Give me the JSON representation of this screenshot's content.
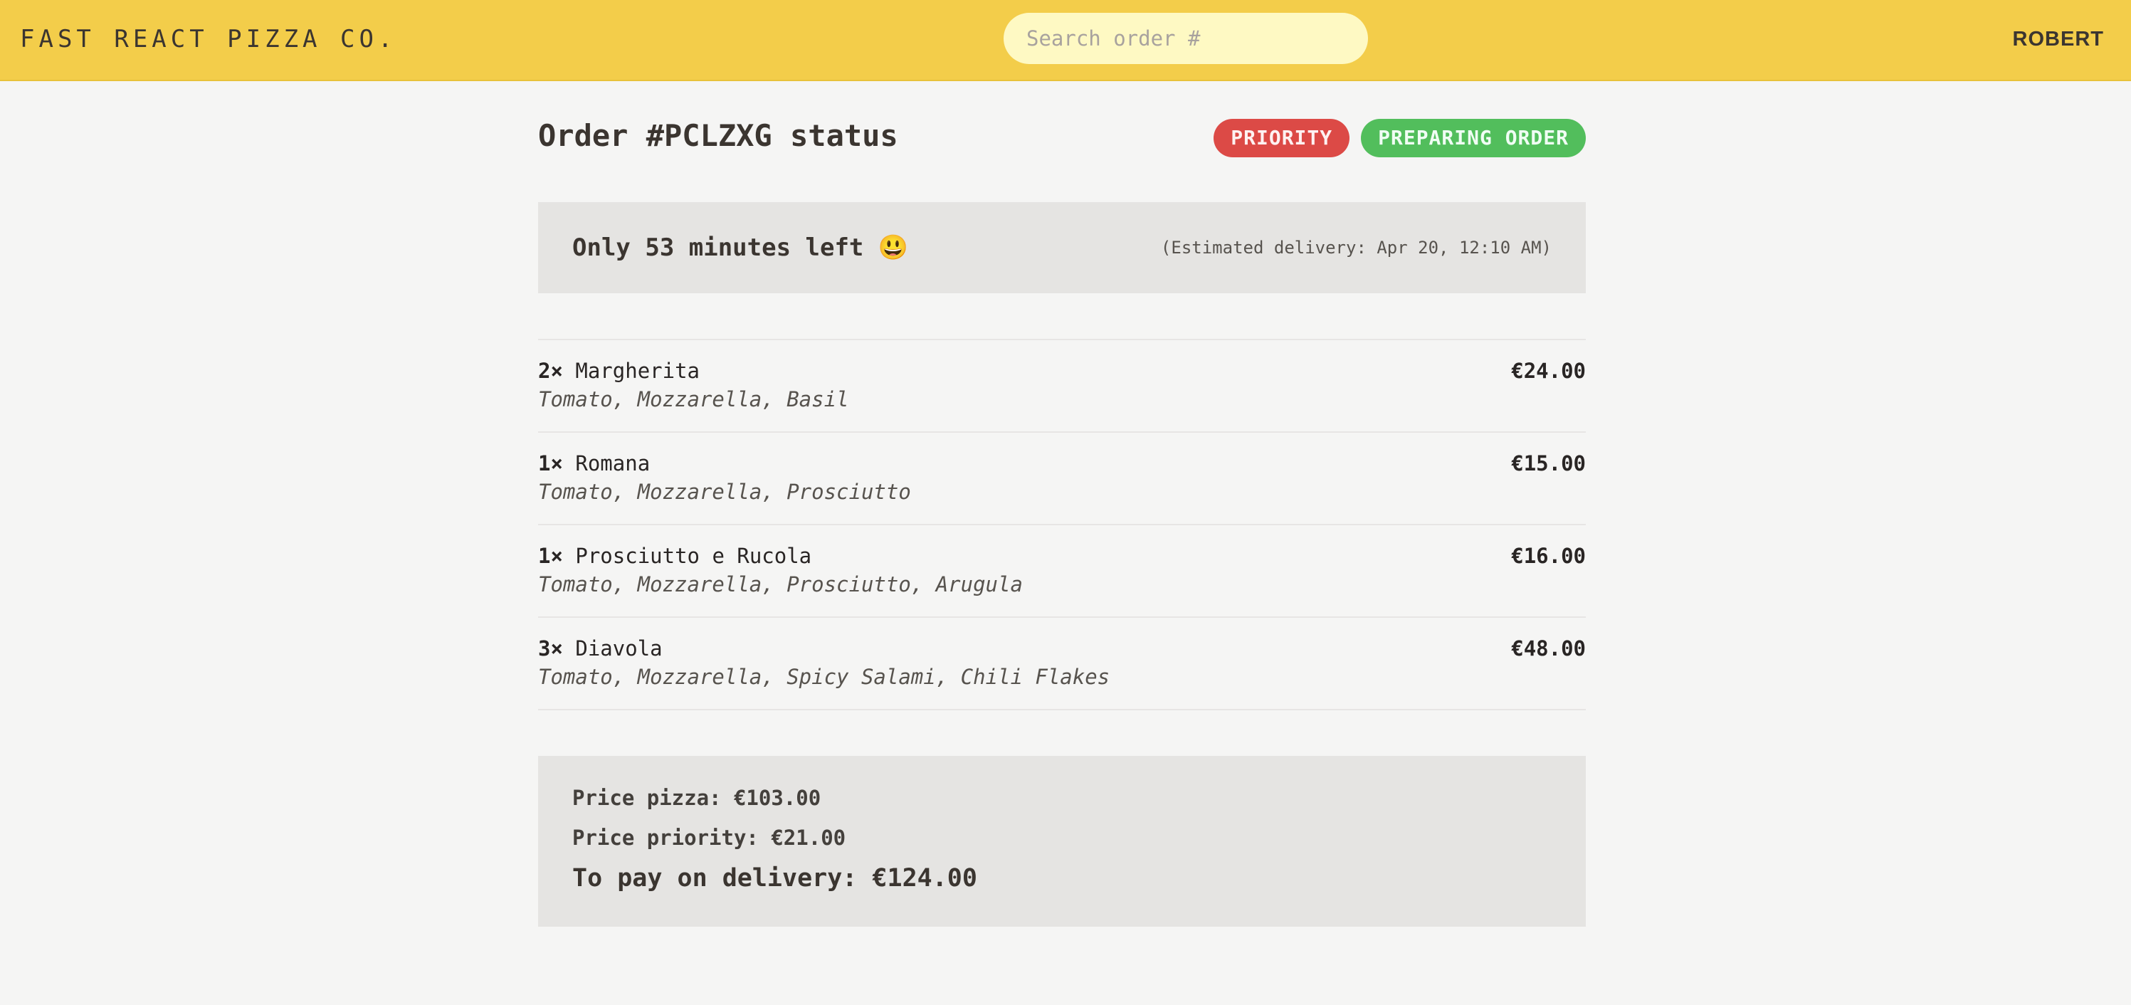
{
  "header": {
    "logo": "Fast React Pizza Co.",
    "search_placeholder": "Search order #",
    "username": "ROBERT"
  },
  "order": {
    "title": "Order #PCLZXG status",
    "badges": {
      "priority": "Priority",
      "status": "Preparing order"
    },
    "eta": {
      "remaining": "Only 53 minutes left 😃",
      "estimated": "(Estimated delivery: Apr 20, 12:10 AM)"
    },
    "items": [
      {
        "qty": "2×",
        "name": "Margherita",
        "price": "€24.00",
        "ingredients": "Tomato, Mozzarella, Basil"
      },
      {
        "qty": "1×",
        "name": "Romana",
        "price": "€15.00",
        "ingredients": "Tomato, Mozzarella, Prosciutto"
      },
      {
        "qty": "1×",
        "name": "Prosciutto e Rucola",
        "price": "€16.00",
        "ingredients": "Tomato, Mozzarella, Prosciutto, Arugula"
      },
      {
        "qty": "3×",
        "name": "Diavola",
        "price": "€48.00",
        "ingredients": "Tomato, Mozzarella, Spicy Salami, Chili Flakes"
      }
    ],
    "summary": {
      "price_pizza": "Price pizza: €103.00",
      "price_priority": "Price priority: €21.00",
      "to_pay": "To pay on delivery: €124.00"
    }
  },
  "colors": {
    "header_bg": "#f3cd4a",
    "search_bg": "#fef9c3",
    "priority_badge": "#dc4a46",
    "status_badge": "#52be5c",
    "panel_bg": "#e5e4e2",
    "page_bg": "#f5f5f4"
  }
}
